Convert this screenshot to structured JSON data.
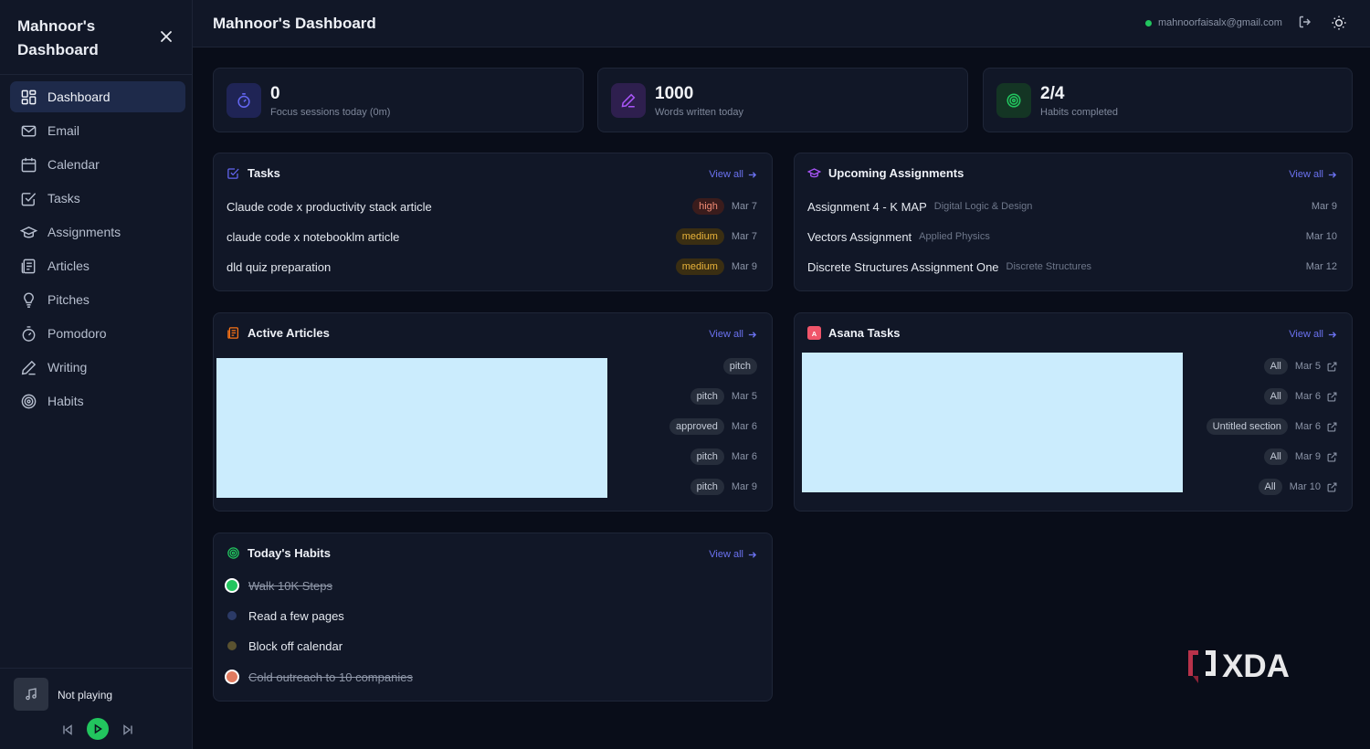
{
  "sidebar": {
    "title": "Mahnoor's Dashboard",
    "nav": [
      {
        "label": "Dashboard",
        "icon": "dashboard-icon",
        "active": true
      },
      {
        "label": "Email",
        "icon": "mail-icon"
      },
      {
        "label": "Calendar",
        "icon": "calendar-icon"
      },
      {
        "label": "Tasks",
        "icon": "tasks-icon"
      },
      {
        "label": "Assignments",
        "icon": "graduation-cap-icon"
      },
      {
        "label": "Articles",
        "icon": "article-icon"
      },
      {
        "label": "Pitches",
        "icon": "lightbulb-icon"
      },
      {
        "label": "Pomodoro",
        "icon": "timer-icon"
      },
      {
        "label": "Writing",
        "icon": "pen-icon"
      },
      {
        "label": "Habits",
        "icon": "target-icon"
      }
    ],
    "player": {
      "status": "Not playing"
    }
  },
  "header": {
    "title": "Mahnoor's Dashboard",
    "email": "mahnoorfaisalx@gmail.com"
  },
  "stats": [
    {
      "value": "0",
      "label": "Focus sessions today (0m)",
      "icon": "timer-icon",
      "color": "#6366f1"
    },
    {
      "value": "1000",
      "label": "Words written today",
      "icon": "pen-icon",
      "color": "#a855f7"
    },
    {
      "value": "2/4",
      "label": "Habits completed",
      "icon": "target-icon",
      "color": "#22c55e"
    }
  ],
  "tasks": {
    "title": "Tasks",
    "view_all": "View all",
    "items": [
      {
        "title": "Claude code x productivity stack article",
        "priority": "high",
        "date": "Mar 7"
      },
      {
        "title": "claude code x notebooklm article",
        "priority": "medium",
        "date": "Mar 7"
      },
      {
        "title": "dld quiz preparation",
        "priority": "medium",
        "date": "Mar 9"
      }
    ]
  },
  "assignments": {
    "title": "Upcoming Assignments",
    "view_all": "View all",
    "items": [
      {
        "title": "Assignment 4 - K MAP",
        "course": "Digital Logic & Design",
        "date": "Mar 9"
      },
      {
        "title": "Vectors Assignment",
        "course": "Applied Physics",
        "date": "Mar 10"
      },
      {
        "title": "Discrete Structures Assignment One",
        "course": "Discrete Structures",
        "date": "Mar 12"
      }
    ]
  },
  "articles": {
    "title": "Active Articles",
    "view_all": "View all",
    "items": [
      {
        "status": "pitch",
        "date": ""
      },
      {
        "status": "pitch",
        "date": "Mar 5"
      },
      {
        "status": "approved",
        "date": "Mar 6"
      },
      {
        "status": "pitch",
        "date": "Mar 6"
      },
      {
        "status": "pitch",
        "date": "Mar 9"
      }
    ]
  },
  "asana": {
    "title": "Asana Tasks",
    "view_all": "View all",
    "items": [
      {
        "section": "All",
        "date": "Mar 5"
      },
      {
        "section": "All",
        "date": "Mar 6"
      },
      {
        "section": "Untitled section",
        "date": "Mar 6"
      },
      {
        "section": "All",
        "date": "Mar 9"
      },
      {
        "section": "All",
        "date": "Mar 10"
      }
    ]
  },
  "habits": {
    "title": "Today's Habits",
    "view_all": "View all",
    "items": [
      {
        "label": "Walk 10K Steps",
        "done": true,
        "color": "#22c55e"
      },
      {
        "label": "Read a few pages",
        "done": false,
        "color": "#2b3a66"
      },
      {
        "label": "Block off calendar",
        "done": false,
        "color": "#5a5230"
      },
      {
        "label": "Cold outreach to 10 companies",
        "done": true,
        "color": "#e07a5f"
      }
    ]
  },
  "watermark": "XDA"
}
